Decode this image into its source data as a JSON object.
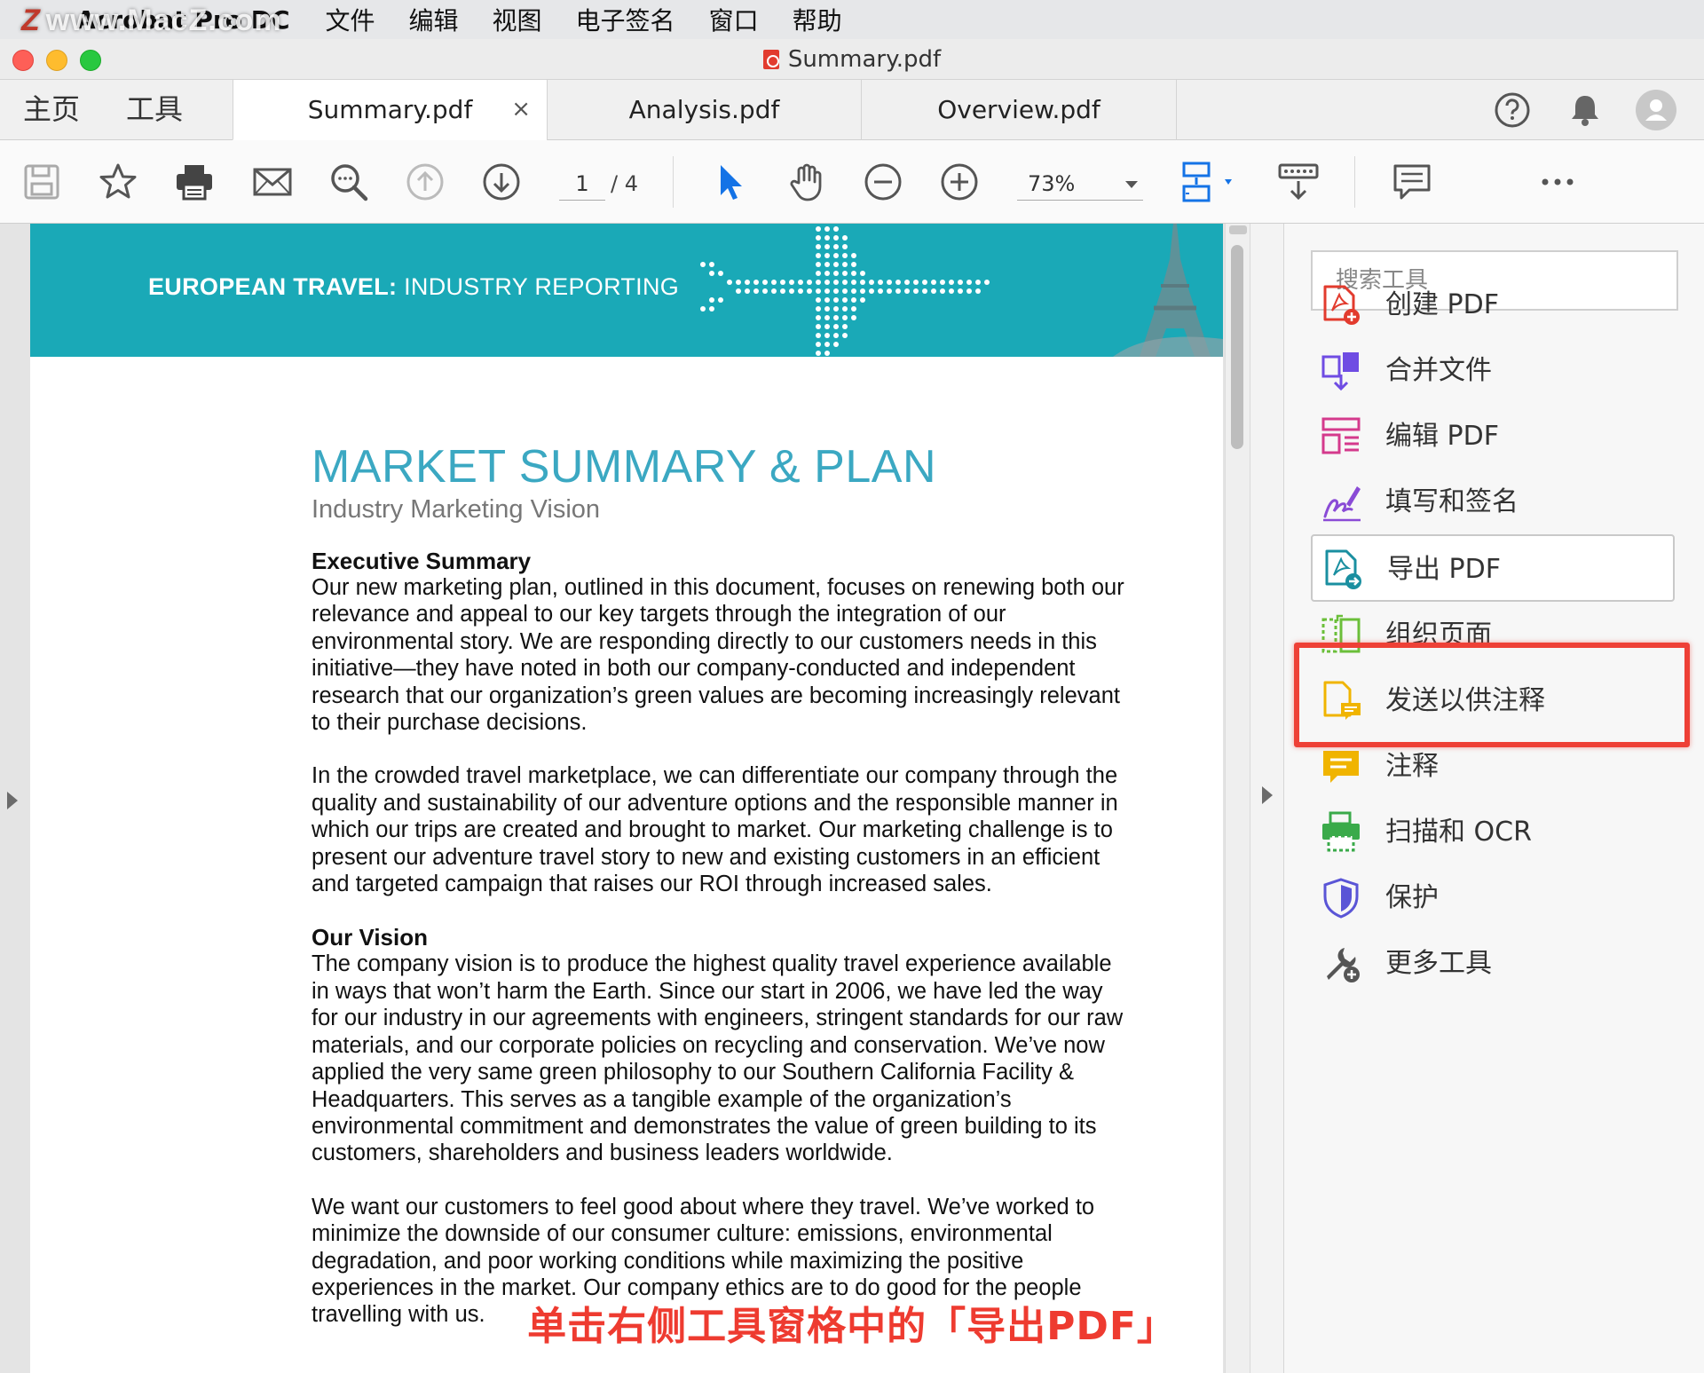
{
  "menubar": {
    "app_name": "Acrobat Pro DC",
    "items": [
      "文件",
      "编辑",
      "视图",
      "电子签名",
      "窗口",
      "帮助"
    ]
  },
  "watermark": "www.MacZ.com",
  "window": {
    "title": "Summary.pdf"
  },
  "nav": {
    "home": "主页",
    "tools": "工具"
  },
  "tabs": [
    {
      "label": "Summary.pdf",
      "close": "×"
    },
    {
      "label": "Analysis.pdf"
    },
    {
      "label": "Overview.pdf"
    }
  ],
  "toolbar": {
    "page_current": "1",
    "page_total": "/ 4",
    "zoom": "73%"
  },
  "document": {
    "banner_bold": "EUROPEAN TRAVEL:",
    "banner_rest": " INDUSTRY REPORTING",
    "title": "MARKET SUMMARY & PLAN",
    "subtitle": "Industry Marketing Vision",
    "sections": [
      {
        "heading": "Executive Summary",
        "paragraphs": [
          "Our new marketing plan, outlined in this document, focuses on renewing both our relevance and appeal to our key targets through the integration of our environmental story. We are responding directly to our customers needs in this initiative—they have noted in both our company-conducted and independent research that our organization’s green values are becoming increasingly relevant to their purchase decisions.",
          "In the crowded travel marketplace, we can differentiate our company through the quality and sustainability of our adventure options and the responsible manner in which our trips are created and brought to market. Our marketing challenge is to present our adventure travel story to new and existing customers in an efficient and targeted campaign that raises our ROI through increased sales."
        ]
      },
      {
        "heading": "Our Vision",
        "paragraphs": [
          "The company vision is to produce the highest quality travel experience available in ways that won’t harm the Earth. Since our start in 2006, we have led the way for our industry in our agreements with engineers, stringent standards for our raw materials, and our corporate policies on recycling and conservation. We’ve now applied the very same green philosophy to our Southern California Facility & Headquarters.  This serves as a tangible example of the organization’s environmental commitment and demonstrates the value of green building to its customers, shareholders and business leaders worldwide.",
          "We want our customers to feel good about where they travel. We’ve worked to minimize the downside of our consumer culture: emissions, environmental degradation, and poor working conditions while maximizing the positive experiences in the market. Our company ethics are to do good for the people travelling with us."
        ]
      }
    ]
  },
  "tools_pane": {
    "search_placeholder": "搜索工具",
    "items": [
      {
        "label": "创建 PDF",
        "icon": "create-pdf-icon",
        "color": "#e23b2e"
      },
      {
        "label": "合并文件",
        "icon": "combine-files-icon",
        "color": "#6f4ce3"
      },
      {
        "label": "编辑 PDF",
        "icon": "edit-pdf-icon",
        "color": "#d43a8c"
      },
      {
        "label": "填写和签名",
        "icon": "fill-sign-icon",
        "color": "#8a4bd6"
      },
      {
        "label": "导出 PDF",
        "icon": "export-pdf-icon",
        "color": "#1a8fa0",
        "selected": true
      },
      {
        "label": "组织页面",
        "icon": "organize-pages-icon",
        "color": "#6bbf3a"
      },
      {
        "label": "发送以供注释",
        "icon": "send-comment-icon",
        "color": "#f0b400"
      },
      {
        "label": "注释",
        "icon": "comment-icon",
        "color": "#f0b400"
      },
      {
        "label": "扫描和 OCR",
        "icon": "scan-ocr-icon",
        "color": "#3aaa4a"
      },
      {
        "label": "保护",
        "icon": "protect-icon",
        "color": "#5a55d6"
      },
      {
        "label": "更多工具",
        "icon": "more-tools-icon",
        "color": "#555555"
      }
    ]
  },
  "caption": "单击右侧工具窗格中的「导出PDF」",
  "colors": {
    "banner": "#1aa9b7",
    "title": "#3ba8c2",
    "highlight": "#ee4036",
    "accent_blue": "#1473e6"
  }
}
